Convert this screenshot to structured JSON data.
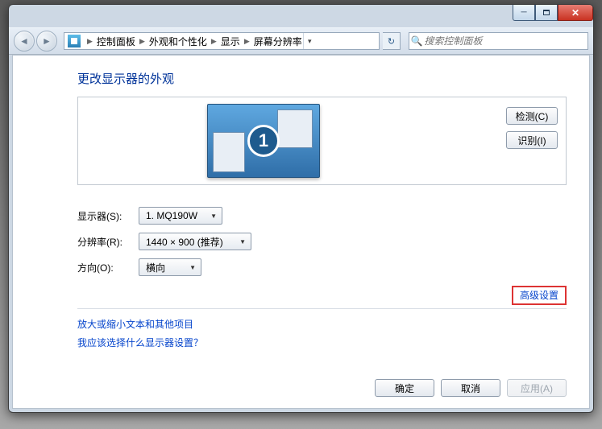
{
  "breadcrumb": {
    "root": "控制面板",
    "l2": "外观和个性化",
    "l3": "显示",
    "l4": "屏幕分辨率"
  },
  "search_placeholder": "搜索控制面板",
  "heading": "更改显示器的外观",
  "detect_btn": "检测(C)",
  "identify_btn": "识别(I)",
  "monitor_number": "1",
  "labels": {
    "display": "显示器(S):",
    "resolution": "分辨率(R):",
    "orientation": "方向(O):"
  },
  "values": {
    "display": "1. MQ190W",
    "resolution": "1440 × 900 (推荐)",
    "orientation": "横向"
  },
  "advanced_link": "高级设置",
  "link_textsize": "放大或缩小文本和其他项目",
  "link_which": "我应该选择什么显示器设置？",
  "buttons": {
    "ok": "确定",
    "cancel": "取消",
    "apply": "应用(A)"
  }
}
